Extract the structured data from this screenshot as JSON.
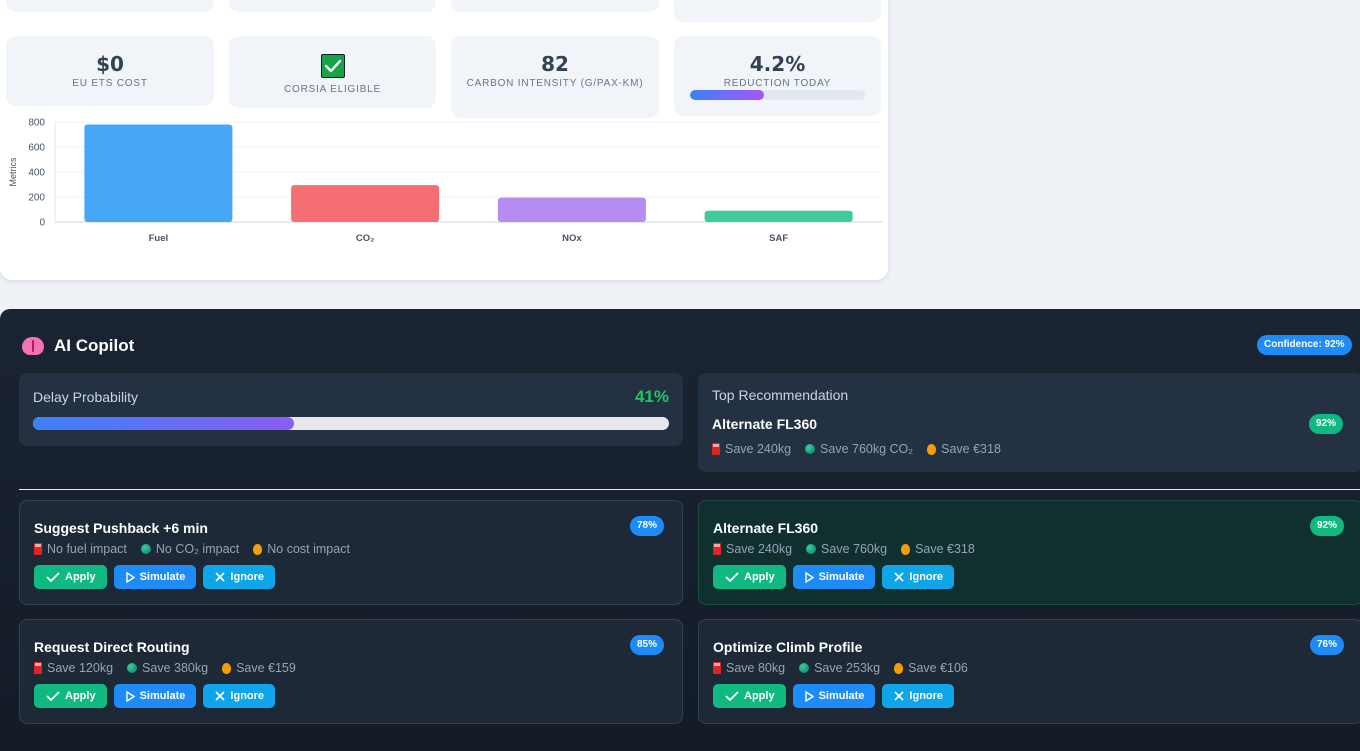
{
  "metrics": {
    "ets": {
      "value": "$0",
      "label": "EU ETS COST"
    },
    "corsia": {
      "label": "CORSIA ELIGIBLE",
      "checked": true
    },
    "intensity": {
      "value": "82",
      "label": "CARBON INTENSITY (G/PAX-KM)"
    },
    "reduction": {
      "value": "4.2%",
      "label": "REDUCTION TODAY",
      "progress_fraction": 0.42
    }
  },
  "chart_data": {
    "type": "bar",
    "categories": [
      "Fuel",
      "CO₂",
      "NOx",
      "SAF"
    ],
    "values": [
      780,
      295,
      195,
      90
    ],
    "colors": [
      "#45a7f5",
      "#f56e73",
      "#b48cf2",
      "#3fcb9c"
    ],
    "ylabel": "Metrics",
    "ylim": [
      0,
      800
    ],
    "yticks": [
      0,
      200,
      400,
      600,
      800
    ],
    "grid": true
  },
  "copilot": {
    "title": "AI Copilot",
    "confidence": "Confidence: 92%",
    "delay": {
      "label": "Delay Probability",
      "value": "41%",
      "fraction": 0.41
    },
    "top": {
      "caption": "Top Recommendation",
      "title": "Alternate FL360",
      "badge": "92%",
      "fuel": "Save 240kg",
      "co2": "Save 760kg CO₂",
      "cost": "Save €318"
    },
    "buttons": {
      "apply": "Apply",
      "simulate": "Simulate",
      "ignore": "Ignore"
    },
    "cards": [
      {
        "title": "Suggest Pushback +6 min",
        "badge": "78%",
        "fuel": "No fuel impact",
        "co2": "No CO₂ impact",
        "cost": "No cost impact"
      },
      {
        "title": "Alternate FL360",
        "badge": "92%",
        "fuel": "Save 240kg",
        "co2": "Save 760kg",
        "cost": "Save €318"
      },
      {
        "title": "Request Direct Routing",
        "badge": "85%",
        "fuel": "Save 120kg",
        "co2": "Save 380kg",
        "cost": "Save €159"
      },
      {
        "title": "Optimize Climb Profile",
        "badge": "76%",
        "fuel": "Save 80kg",
        "co2": "Save 253kg",
        "cost": "Save €106"
      }
    ]
  }
}
